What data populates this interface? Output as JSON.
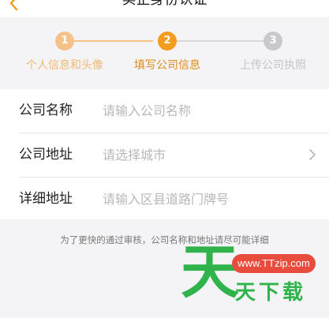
{
  "header": {
    "title": "实企身份认证"
  },
  "steps": [
    {
      "number": "1",
      "label": "个人信息和头像",
      "state": "done"
    },
    {
      "number": "2",
      "label": "填写公司信息",
      "state": "active"
    },
    {
      "number": "3",
      "label": "上传公司执照",
      "state": "pending"
    }
  ],
  "colors": {
    "done": "#f5c28a",
    "active": "#f39c1f",
    "pending": "#c9c9cc",
    "done_text": "#f2b872",
    "active_text": "#e08a1c",
    "pending_text": "#c4c4c8"
  },
  "form": {
    "rows": [
      {
        "label": "公司名称",
        "placeholder": "请输入公司名称"
      },
      {
        "label": "公司地址",
        "placeholder": "请选择城市"
      },
      {
        "label": "详细地址",
        "placeholder": "请输入区县道路门牌号"
      }
    ]
  },
  "hint": "为了更快的通过审核，公司名称和地址请尽可能详细",
  "watermark": {
    "url": "www.TTzip.com",
    "big": "天",
    "small": "天下载"
  }
}
